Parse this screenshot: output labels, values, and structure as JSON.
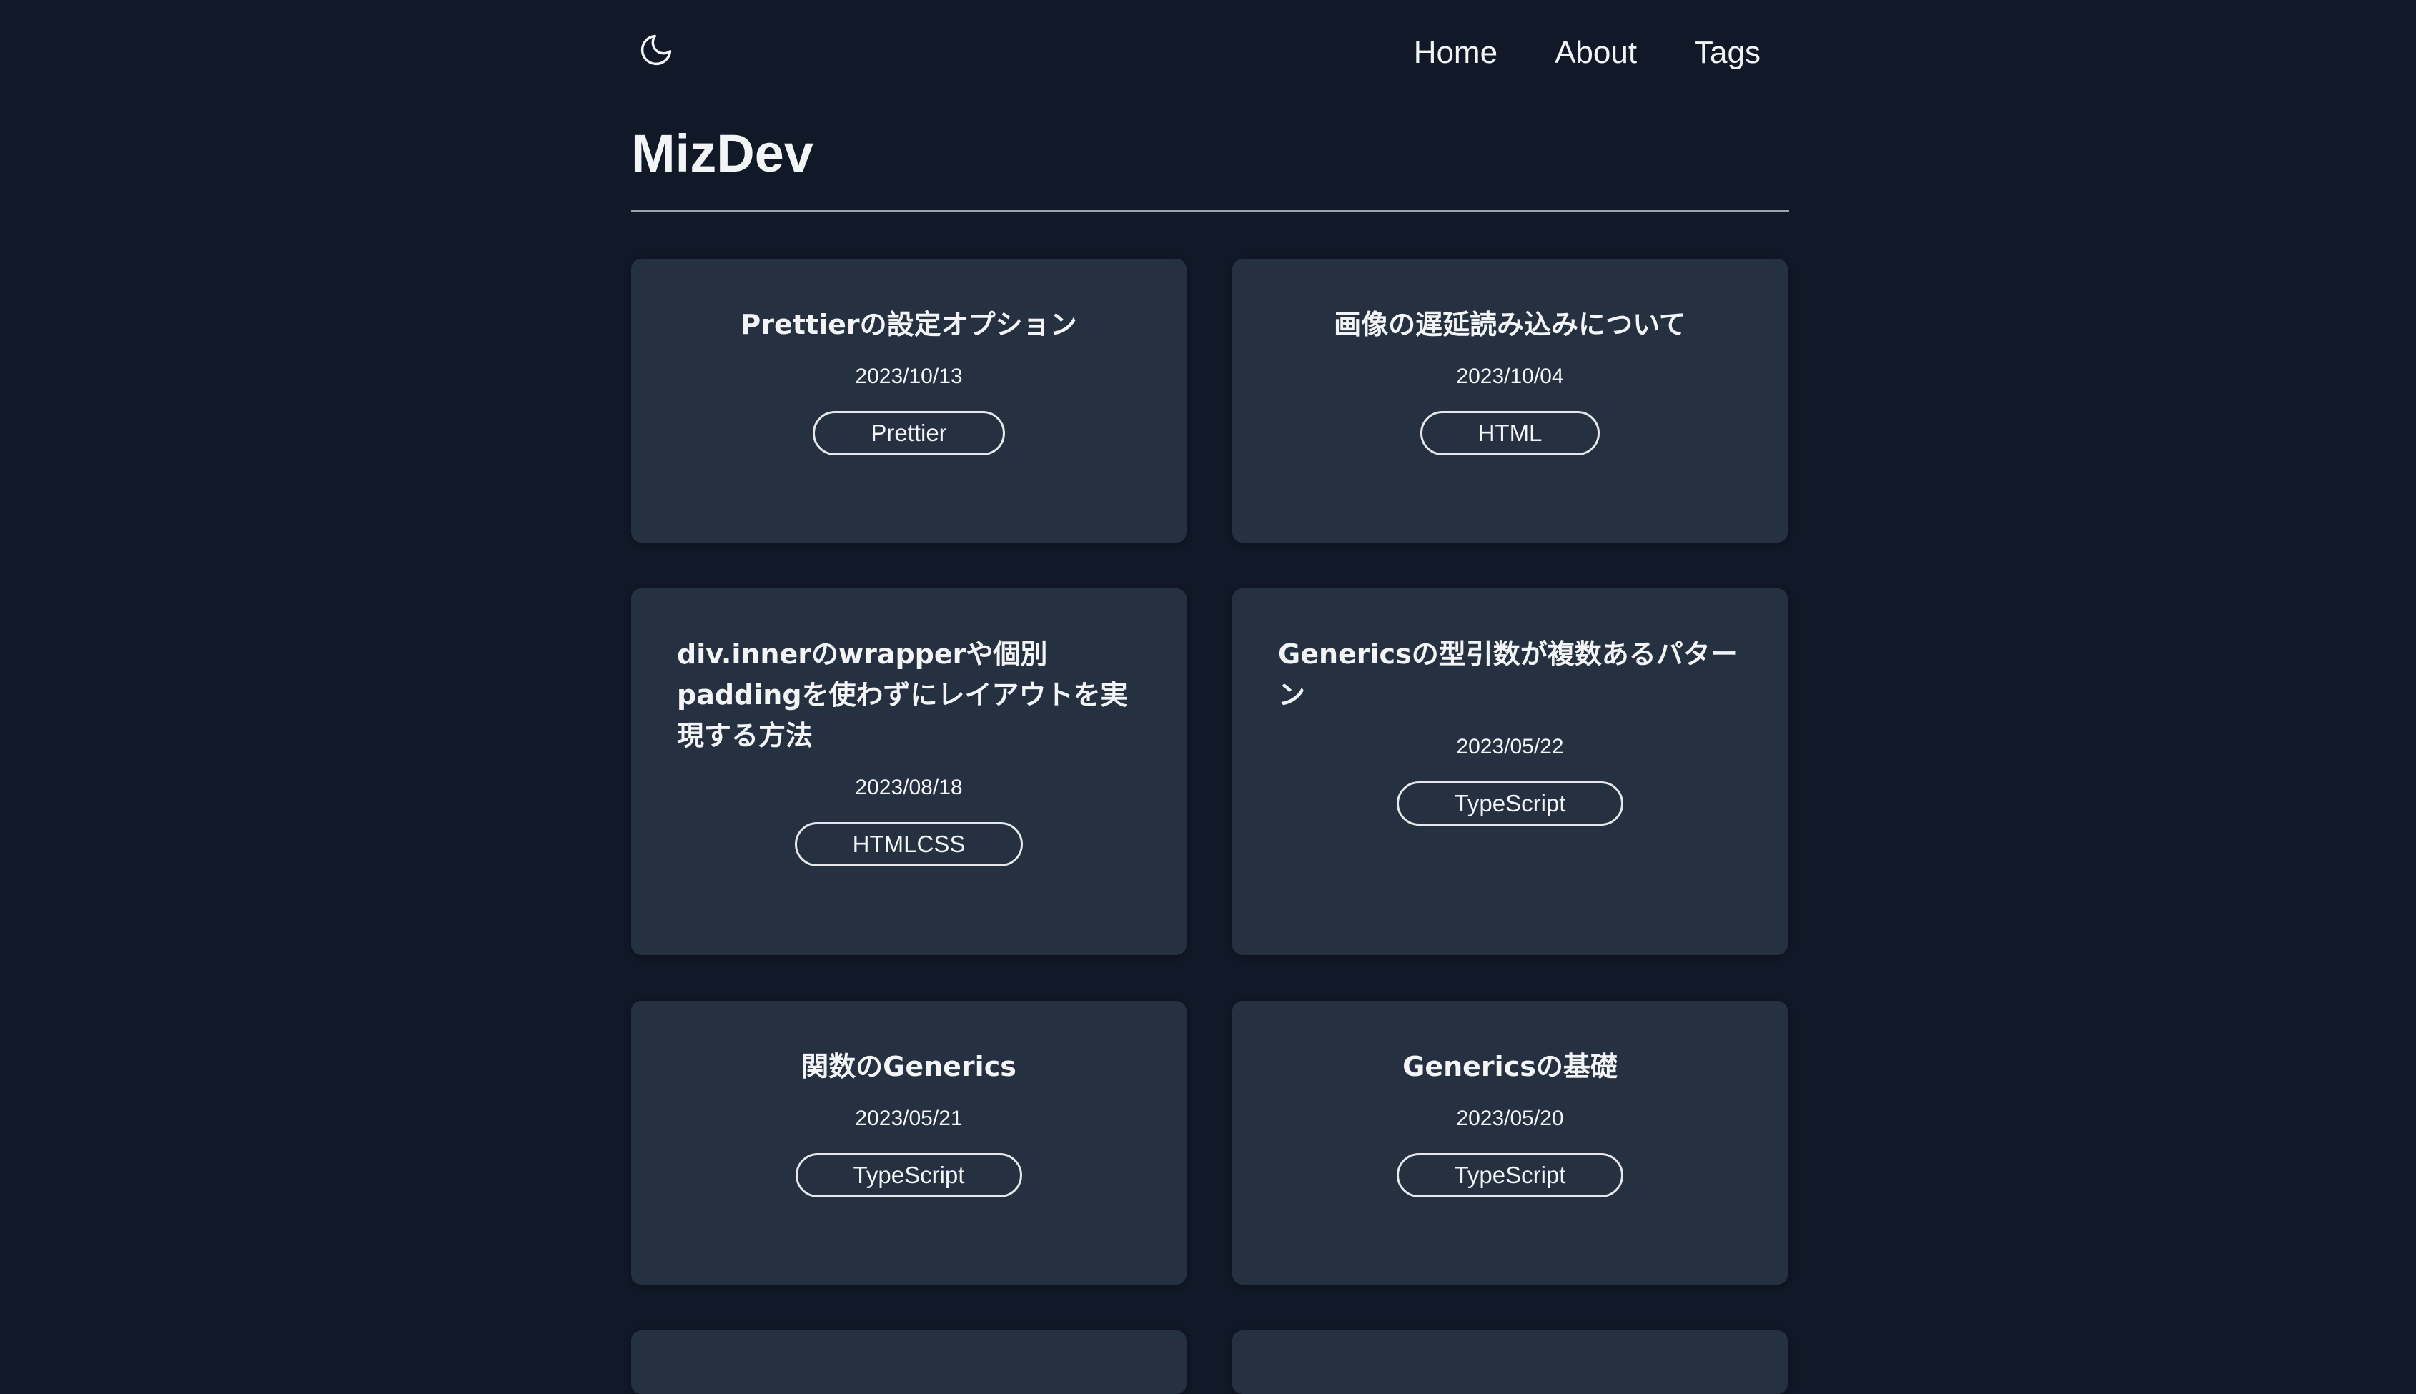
{
  "header": {
    "theme_icon": "moon-icon",
    "nav": [
      {
        "label": "Home"
      },
      {
        "label": "About"
      },
      {
        "label": "Tags"
      }
    ]
  },
  "site": {
    "title": "MizDev"
  },
  "posts": [
    {
      "title": "Prettierの設定オプション",
      "date": "2023/10/13",
      "tag": "Prettier"
    },
    {
      "title": "画像の遅延読み込みについて",
      "date": "2023/10/04",
      "tag": "HTML"
    },
    {
      "title": "div.innerのwrapperや個別paddingを使わずにレイアウトを実現する方法",
      "date": "2023/08/18",
      "tag": "HTMLCSS"
    },
    {
      "title": "Genericsの型引数が複数あるパターン",
      "date": "2023/05/22",
      "tag": "TypeScript"
    },
    {
      "title": "関数のGenerics",
      "date": "2023/05/21",
      "tag": "TypeScript"
    },
    {
      "title": "Genericsの基礎",
      "date": "2023/05/20",
      "tag": "TypeScript"
    }
  ],
  "colors": {
    "background": "#111827",
    "card": "#253041",
    "text": "#f3f4f6"
  }
}
